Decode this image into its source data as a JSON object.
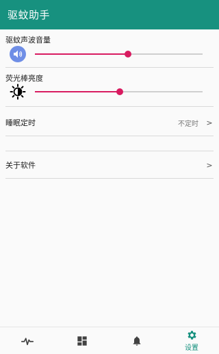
{
  "app": {
    "title": "驱蚊助手",
    "accent": "#17917f",
    "slider_color": "#d81b60"
  },
  "volume": {
    "label": "驱蚊声波音量",
    "icon": "speaker-icon",
    "value": 0.555
  },
  "brightness": {
    "label": "荧光棒亮度",
    "icon": "brightness-icon",
    "value": 0.505
  },
  "settings": {
    "sleep_timer": {
      "label": "睡眠定时",
      "value": "不定时",
      "arrow": ">"
    },
    "about": {
      "label": "关于软件",
      "arrow": ">"
    }
  },
  "bottom_nav": {
    "items": [
      {
        "icon": "pulse-icon",
        "label": ""
      },
      {
        "icon": "dashboard-icon",
        "label": ""
      },
      {
        "icon": "bell-icon",
        "label": ""
      },
      {
        "icon": "gear-icon",
        "label": "设置",
        "active": true
      }
    ]
  }
}
